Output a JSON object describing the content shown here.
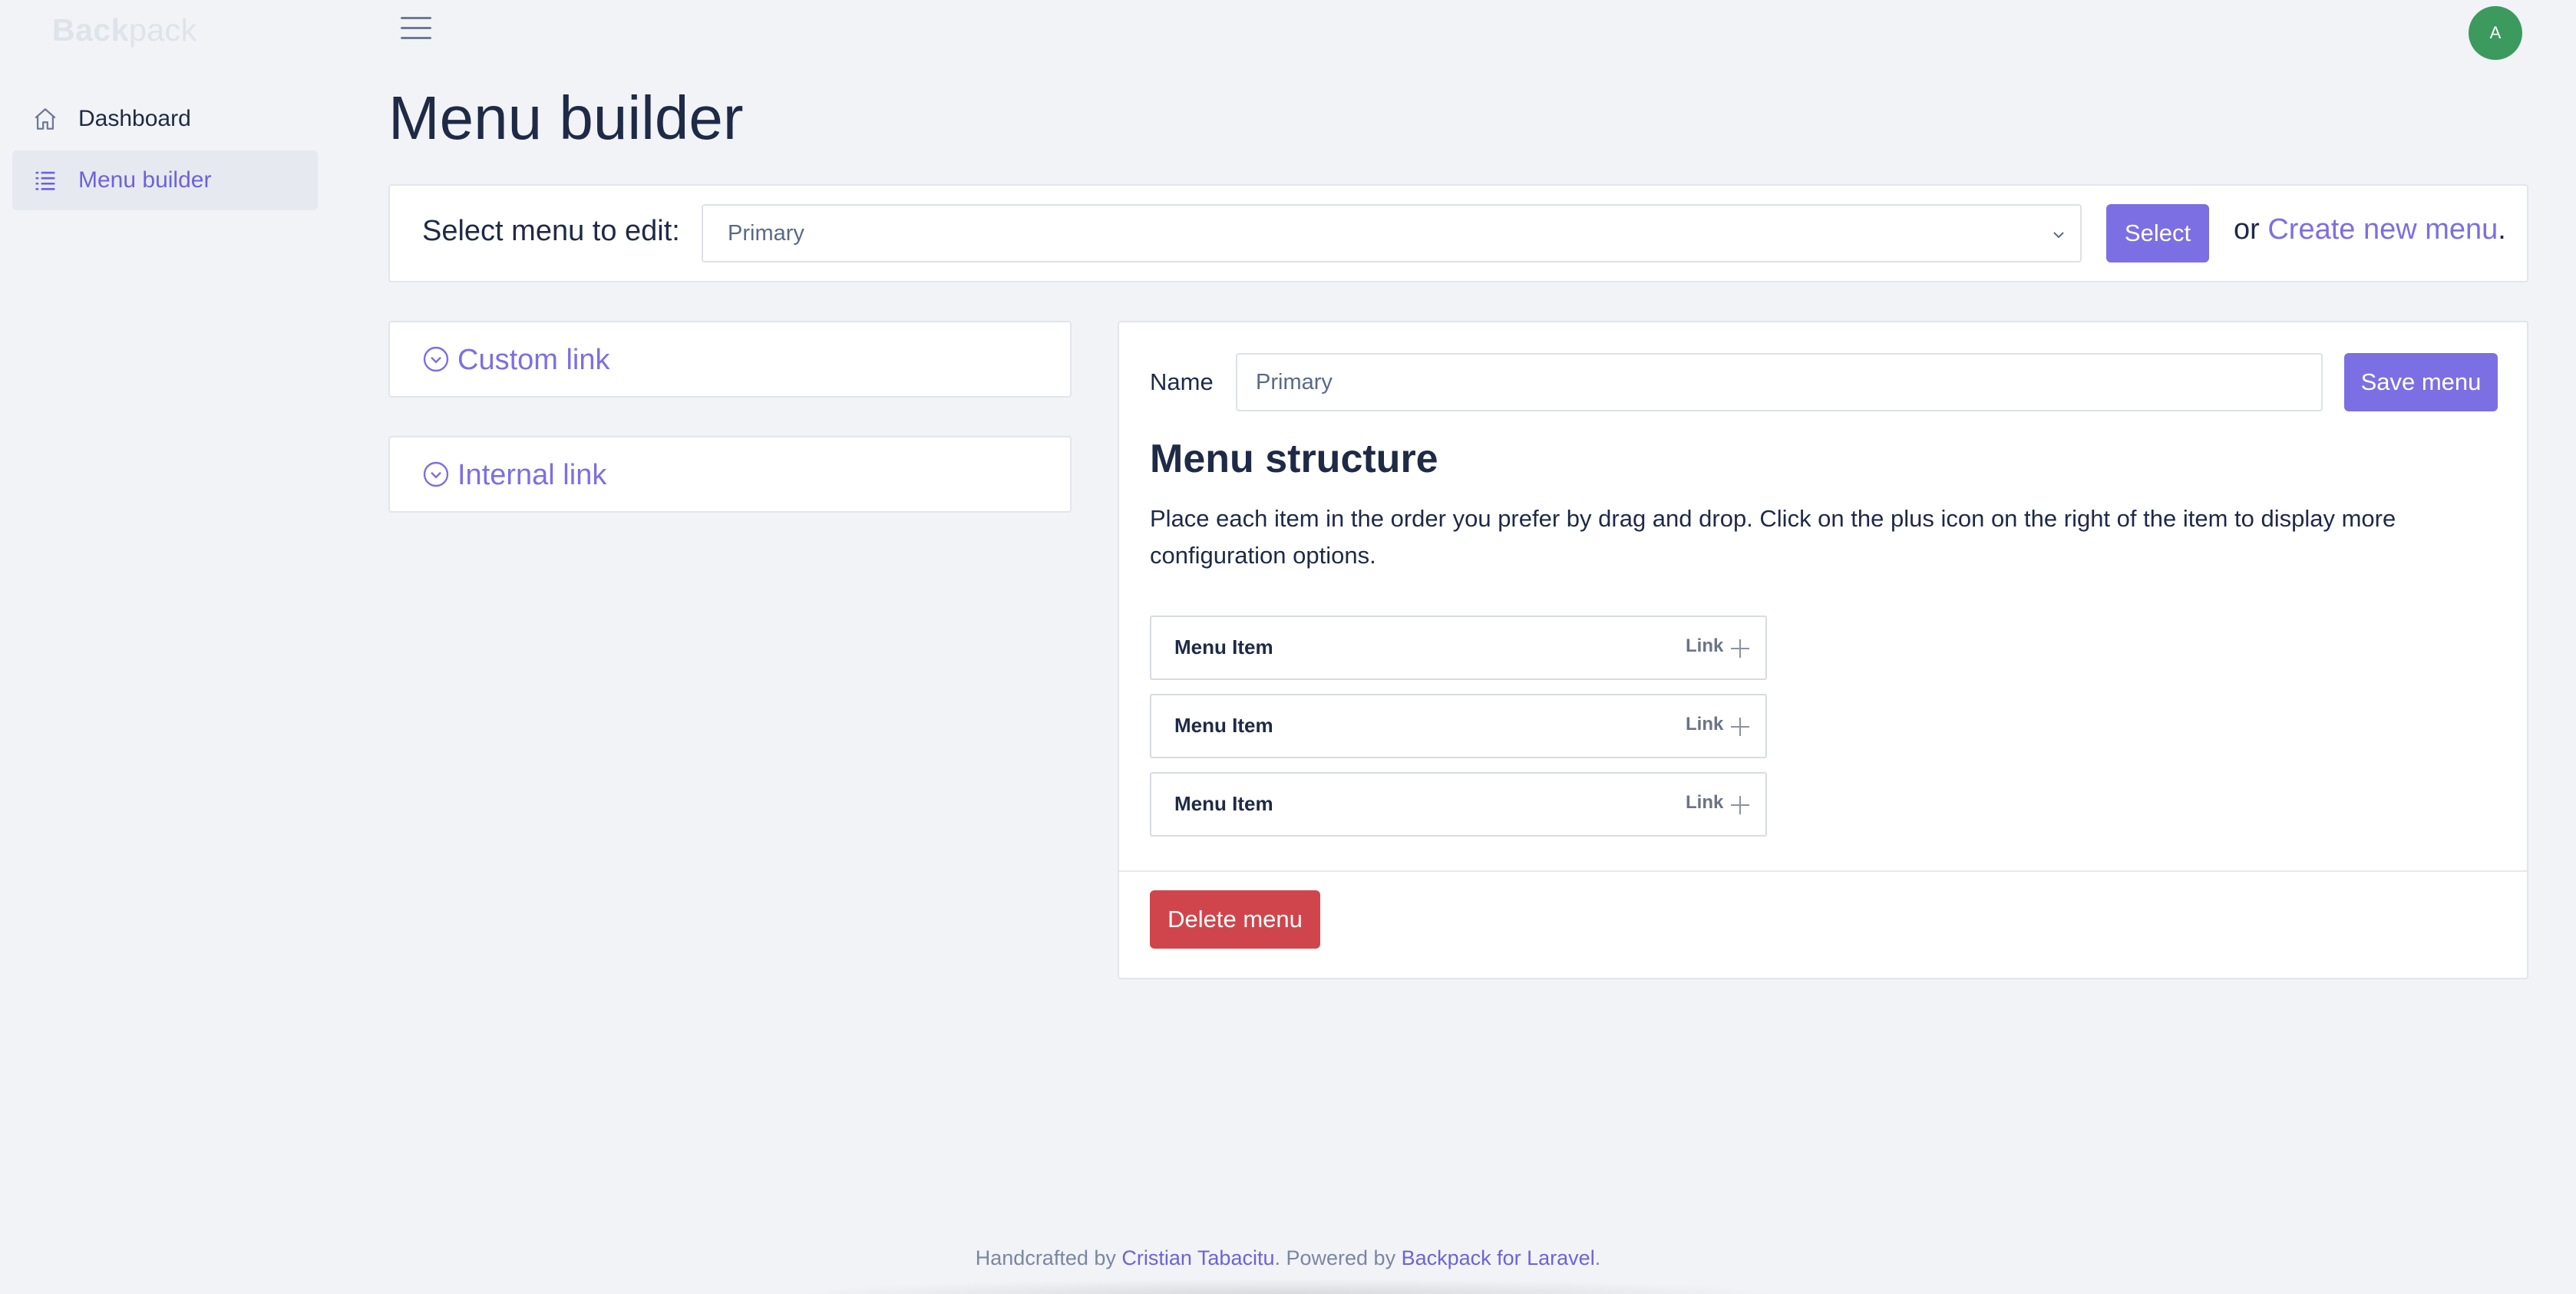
{
  "brand": {
    "bold": "Back",
    "light": "pack"
  },
  "sidebar": {
    "items": [
      {
        "label": "Dashboard",
        "icon": "home-icon"
      },
      {
        "label": "Menu builder",
        "icon": "list-icon"
      }
    ]
  },
  "header": {
    "avatar_initial": "A"
  },
  "page": {
    "title": "Menu builder"
  },
  "menu_select": {
    "label": "Select menu to edit:",
    "selected": "Primary",
    "button": "Select",
    "or_text": "or ",
    "create_link": "Create new menu",
    "period": "."
  },
  "panels": [
    {
      "label": "Custom link",
      "icon": "chevron-circle-down-icon"
    },
    {
      "label": "Internal link",
      "icon": "chevron-circle-down-icon"
    }
  ],
  "menu_editor": {
    "name_label": "Name",
    "name_value": "Primary",
    "save_button": "Save menu",
    "structure_title": "Menu structure",
    "structure_desc": "Place each item in the order you prefer by drag and drop. Click on the plus icon on the right of the item to display more configuration options.",
    "items": [
      {
        "title": "Menu Item",
        "type": "Link"
      },
      {
        "title": "Menu Item",
        "type": "Link"
      },
      {
        "title": "Menu Item",
        "type": "Link"
      }
    ],
    "delete_button": "Delete menu"
  },
  "footer": {
    "handcrafted": "Handcrafted by ",
    "author": "Cristian Tabacitu",
    "powered": ". Powered by ",
    "product": "Backpack for Laravel",
    "period": "."
  },
  "colors": {
    "accent": "#7c6fe3",
    "danger": "#d0454c",
    "avatar": "#3c9a5f",
    "background": "#f1f3f7"
  }
}
